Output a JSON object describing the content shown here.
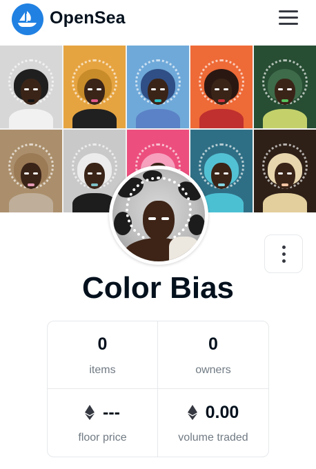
{
  "header": {
    "brand_name": "OpenSea",
    "logo_icon": "opensea-boat-logo",
    "menu_icon": "hamburger-menu-icon",
    "brand_color": "#2081e2"
  },
  "banner": {
    "tiles": [
      {
        "bg": "#d7d7d7",
        "hair": "#1f1f1f",
        "body": "#f1f1f1",
        "lips": "#141414"
      },
      {
        "bg": "#e6a441",
        "hair": "#c88c2a",
        "body": "#202020",
        "lips": "#e05a8a"
      },
      {
        "bg": "#6fa9d9",
        "hair": "#2f4f86",
        "body": "#5b82c6",
        "lips": "#2dbfc2"
      },
      {
        "bg": "#ee6a37",
        "hair": "#2b1712",
        "body": "#c0302e",
        "lips": "#d1303a"
      },
      {
        "bg": "#274d33",
        "hair": "#3e6b4a",
        "body": "#c4d16b",
        "lips": "#56c25c"
      },
      {
        "bg": "#ab8f6c",
        "hair": "#9b7a56",
        "body": "#bfae9a",
        "lips": "#e49ab5"
      },
      {
        "bg": "#c9c9c9",
        "hair": "#ececec",
        "body": "#1d1d1d",
        "lips": "#7ec0c6"
      },
      {
        "bg": "#ec4f7e",
        "hair": "#f6a0be",
        "body": "#f5d0dc",
        "lips": "#f08aa8"
      },
      {
        "bg": "#2f6f85",
        "hair": "#53c1d4",
        "body": "#4cc0d3",
        "lips": "#83d4e0"
      },
      {
        "bg": "#2e2017",
        "hair": "#e8d6ae",
        "body": "#e3cf9d",
        "lips": "#f2c4a4"
      }
    ]
  },
  "collection": {
    "name": "Color Bias",
    "more_options_icon": "vertical-dots-icon"
  },
  "stats": [
    {
      "value": "0",
      "label": "items",
      "icon": ""
    },
    {
      "value": "0",
      "label": "owners",
      "icon": ""
    },
    {
      "value": "---",
      "label": "floor price",
      "icon": "ethereum-icon"
    },
    {
      "value": "0.00",
      "label": "volume traded",
      "icon": "ethereum-icon"
    }
  ]
}
